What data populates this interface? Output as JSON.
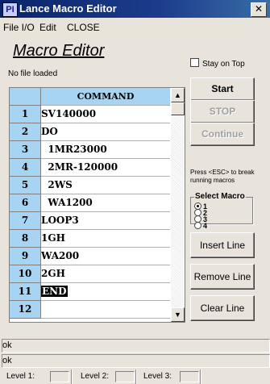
{
  "window": {
    "icon_text": "PI",
    "title": "Lance Macro Editor",
    "close_glyph": "✕"
  },
  "menu": {
    "items": [
      "File I/O",
      "Edit",
      "CLOSE"
    ]
  },
  "page": {
    "title": "Macro Editor",
    "file_status": "No file loaded",
    "stay_on_top": {
      "label": "Stay on Top",
      "checked": false
    }
  },
  "grid": {
    "header": "COMMAND",
    "rows": [
      {
        "num": "1",
        "cmd": "SV140000"
      },
      {
        "num": "2",
        "cmd": "DO"
      },
      {
        "num": "3",
        "cmd": "  1MR23000"
      },
      {
        "num": "4",
        "cmd": "  2MR-120000"
      },
      {
        "num": "5",
        "cmd": "  2WS"
      },
      {
        "num": "6",
        "cmd": "  WA1200"
      },
      {
        "num": "7",
        "cmd": "LOOP3"
      },
      {
        "num": "8",
        "cmd": "1GH"
      },
      {
        "num": "9",
        "cmd": "WA200"
      },
      {
        "num": "10",
        "cmd": "2GH"
      },
      {
        "num": "11",
        "cmd": "END"
      },
      {
        "num": "12",
        "cmd": ""
      }
    ],
    "scroll_up_glyph": "▲",
    "scroll_down_glyph": "▼"
  },
  "controls": {
    "start": "Start",
    "stop": "STOP",
    "continue": "Continue",
    "hint": "Press <ESC> to break running macros",
    "select_macro": {
      "label": "Select Macro",
      "options": [
        "1",
        "2",
        "3",
        "4"
      ],
      "selected": "1"
    },
    "insert_line": "Insert Line",
    "remove_line": "Remove Line",
    "clear_line": "Clear Line"
  },
  "status": {
    "line1": "ok",
    "line2": "ok",
    "levels": [
      "Level 1:",
      "Level 2:",
      "Level 3:"
    ]
  }
}
